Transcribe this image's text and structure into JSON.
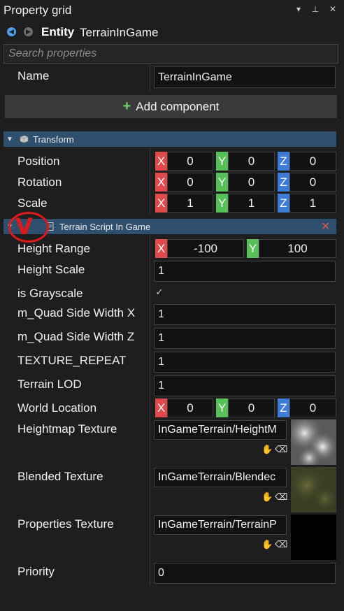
{
  "window": {
    "title": "Property grid",
    "buttons": {
      "dropdown_glyph": "▾",
      "pin_glyph": "⊥",
      "close_glyph": "✕"
    }
  },
  "entity": {
    "prefix": "Entity",
    "name": "TerrainInGame"
  },
  "search": {
    "placeholder": "Search properties",
    "value": ""
  },
  "name_row": {
    "label": "Name",
    "value": "TerrainInGame"
  },
  "add_component": {
    "label": "Add component",
    "icon": "plus-icon"
  },
  "transform": {
    "header": "Transform",
    "rows": [
      {
        "label": "Position",
        "x": "0",
        "y": "0",
        "z": "0"
      },
      {
        "label": "Rotation",
        "x": "0",
        "y": "0",
        "z": "0"
      },
      {
        "label": "Scale",
        "x": "1",
        "y": "1",
        "z": "1"
      }
    ]
  },
  "axes": {
    "x": "X",
    "y": "Y",
    "z": "Z"
  },
  "script": {
    "header": "Terrain Script In Game",
    "height_range": {
      "label": "Height Range",
      "x": "-100",
      "y": "100"
    },
    "height_scale": {
      "label": "Height Scale",
      "value": "1"
    },
    "is_grayscale": {
      "label": "is Grayscale",
      "checked": true,
      "glyph": "✓"
    },
    "quad_x": {
      "label": "m_Quad Side Width X",
      "value": "1"
    },
    "quad_z": {
      "label": "m_Quad Side Width Z",
      "value": "1"
    },
    "texture_repeat": {
      "label": "TEXTURE_REPEAT",
      "value": "1"
    },
    "terrain_lod": {
      "label": "Terrain LOD",
      "value": "1"
    },
    "world_location": {
      "label": "World Location",
      "x": "0",
      "y": "0",
      "z": "0"
    },
    "heightmap": {
      "label": "Heightmap Texture",
      "value": "InGameTerrain/HeightM"
    },
    "blended": {
      "label": "Blended Texture",
      "value": "InGameTerrain/Blendec"
    },
    "properties_tex": {
      "label": "Properties Texture",
      "value": "InGameTerrain/TerrainP"
    },
    "priority": {
      "label": "Priority",
      "value": "0"
    }
  },
  "colors": {
    "accent_section": "#2f4f6f",
    "axis_x": "#e04a4a",
    "axis_y": "#58c058",
    "axis_z": "#3d7bd4",
    "annotation": "#e0191b"
  }
}
